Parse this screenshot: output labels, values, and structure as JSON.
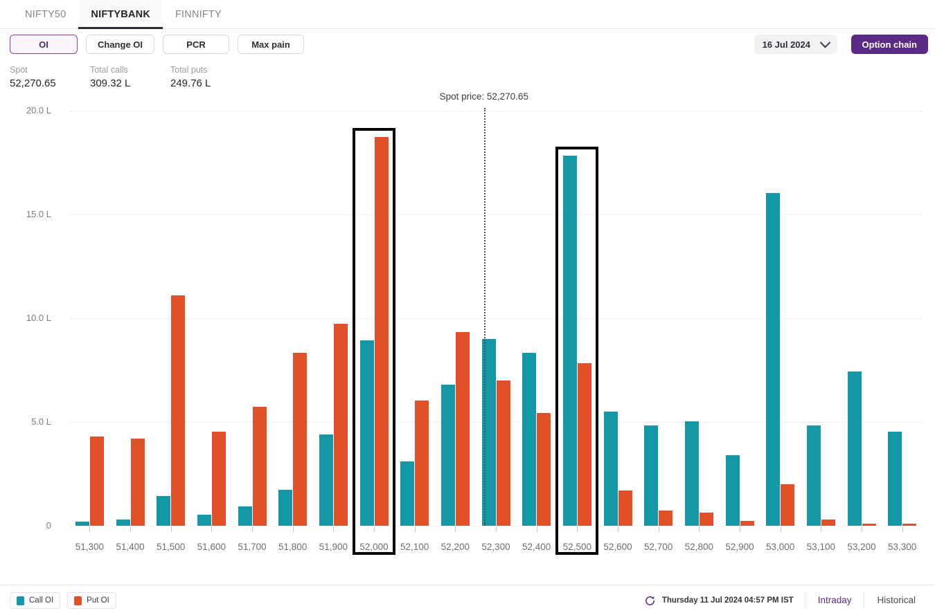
{
  "tabs": [
    {
      "label": "NIFTY50",
      "active": false
    },
    {
      "label": "NIFTYBANK",
      "active": true
    },
    {
      "label": "FINNIFTY",
      "active": false
    }
  ],
  "toolbar": {
    "segments": [
      {
        "label": "OI",
        "active": true
      },
      {
        "label": "Change OI",
        "active": false
      },
      {
        "label": "PCR",
        "active": false
      },
      {
        "label": "Max pain",
        "active": false
      }
    ],
    "expiry_value": "16 Jul 2024",
    "option_chain_label": "Option chain"
  },
  "stats": [
    {
      "label": "Spot",
      "value": "52,270.65"
    },
    {
      "label": "Total calls",
      "value": "309.32 L"
    },
    {
      "label": "Total puts",
      "value": "249.76 L"
    }
  ],
  "footer": {
    "legend": [
      {
        "label": "Call OI",
        "color": "#1598a6"
      },
      {
        "label": "Put OI",
        "color": "#e0512a"
      }
    ],
    "timestamp": "Thursday 11 Jul 2024 04:57 PM IST",
    "buttons": [
      {
        "label": "Intraday",
        "active": true
      },
      {
        "label": "Historical",
        "active": false
      }
    ]
  },
  "chart_data": {
    "type": "bar",
    "title": "",
    "xlabel": "",
    "ylabel": "",
    "ylim": [
      0,
      20
    ],
    "yunit": "L",
    "ytick_labels": [
      "0",
      "5.0 L",
      "10.0 L",
      "15.0 L",
      "20.0 L"
    ],
    "ytick_values": [
      0,
      5,
      10,
      15,
      20
    ],
    "grid": true,
    "legend_position": "bottom-left",
    "categories": [
      "51,300",
      "51,400",
      "51,500",
      "51,600",
      "51,700",
      "51,800",
      "51,900",
      "52,000",
      "52,100",
      "52,200",
      "52,300",
      "52,400",
      "52,500",
      "52,600",
      "52,700",
      "52,800",
      "52,900",
      "53,000",
      "53,100",
      "53,200",
      "53,300"
    ],
    "series": [
      {
        "name": "Call OI",
        "color": "#1598a6",
        "values": [
          0.2,
          0.3,
          1.45,
          0.55,
          0.95,
          1.75,
          4.4,
          8.95,
          3.1,
          6.8,
          9.0,
          8.35,
          17.85,
          5.5,
          4.85,
          5.05,
          3.4,
          16.05,
          4.85,
          7.45,
          4.55
        ]
      },
      {
        "name": "Put OI",
        "color": "#e0512a",
        "values": [
          4.3,
          4.2,
          11.1,
          4.55,
          5.75,
          8.35,
          9.75,
          18.75,
          6.05,
          9.35,
          7.0,
          5.45,
          7.85,
          1.7,
          0.75,
          0.65,
          0.25,
          2.0,
          0.3,
          0.1,
          0.1
        ]
      }
    ],
    "annotations": [
      {
        "type": "vline",
        "label": "Spot price: 52,270.65",
        "x_value": 52270.65
      }
    ],
    "highlighted_categories": [
      "52,000",
      "52,500"
    ]
  }
}
